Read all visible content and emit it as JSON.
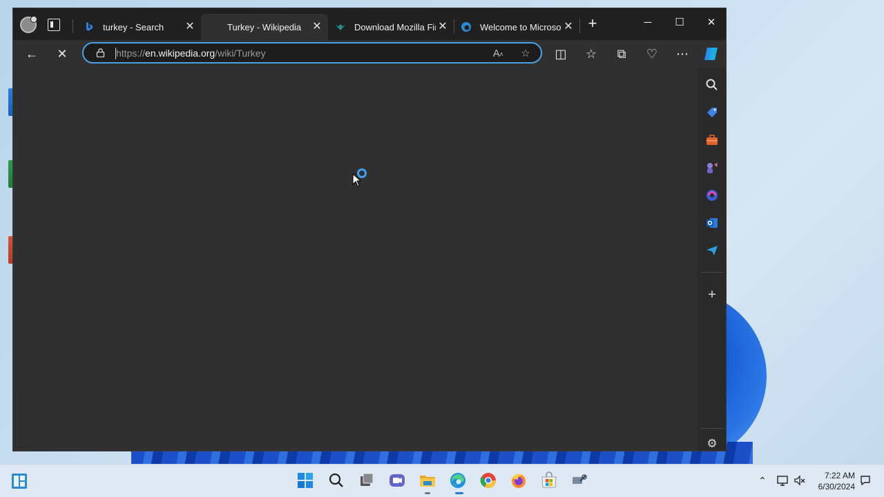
{
  "tabs": [
    {
      "title": "turkey - Search",
      "icon": "bing-icon"
    },
    {
      "title": "Turkey - Wikipedia",
      "icon": "loading-icon"
    },
    {
      "title": "Download Mozilla Fire",
      "icon": "mozilla-icon"
    },
    {
      "title": "Welcome to Microsoft",
      "icon": "edge-icon"
    }
  ],
  "address": {
    "scheme": "https://",
    "host": "en.wikipedia.org",
    "path": "/wiki/Turkey"
  },
  "clock": {
    "time": "7:22 AM",
    "date": "6/30/2024"
  },
  "colors": {
    "accent": "#4aa3e8",
    "window_bg": "#303030",
    "titlebar_bg": "#202020"
  }
}
